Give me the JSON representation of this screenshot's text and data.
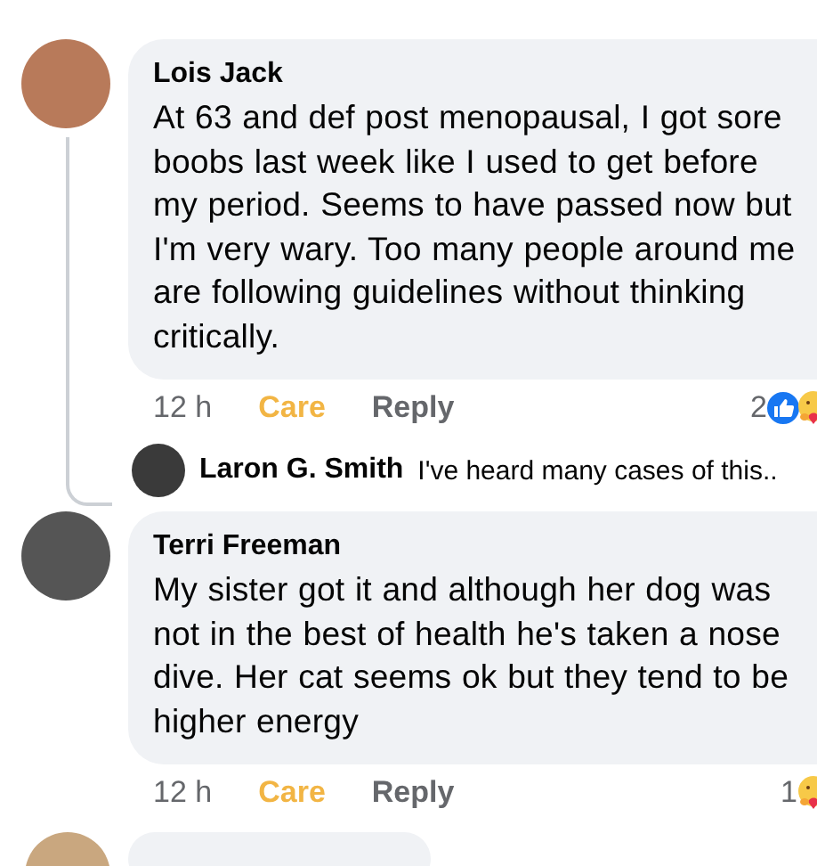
{
  "comments": [
    {
      "author": "Lois Jack",
      "text": "At 63 and def post menopausal, I got sore boobs last week like I used to get before my period. Seems to have passed now but I'm very wary. Too many people around me are following guidelines without thinking critically.",
      "actions": [
        {
          "label": "12 h",
          "kind": "time"
        },
        {
          "label": "Care",
          "kind": "reaction",
          "selected": true
        },
        {
          "label": "Reply",
          "kind": "reply"
        }
      ],
      "reaction_count": "2",
      "reactions": [
        {
          "kind": "like"
        },
        {
          "kind": "care"
        }
      ],
      "replies": [
        {
          "author": "Laron G. Smith",
          "text": "I've heard many cases of this.."
        }
      ]
    },
    {
      "author": "Terri Freeman",
      "text": "My sister got it and although her dog was not in the best of health he's taken a nose dive.  Her cat seems ok but they tend to be higher energy",
      "actions": [
        {
          "label": "12 h",
          "kind": "time"
        },
        {
          "label": "Care",
          "kind": "reaction",
          "selected": true
        },
        {
          "label": "Reply",
          "kind": "reply"
        }
      ],
      "reaction_count": "1",
      "reactions": [
        {
          "kind": "care"
        }
      ]
    }
  ]
}
